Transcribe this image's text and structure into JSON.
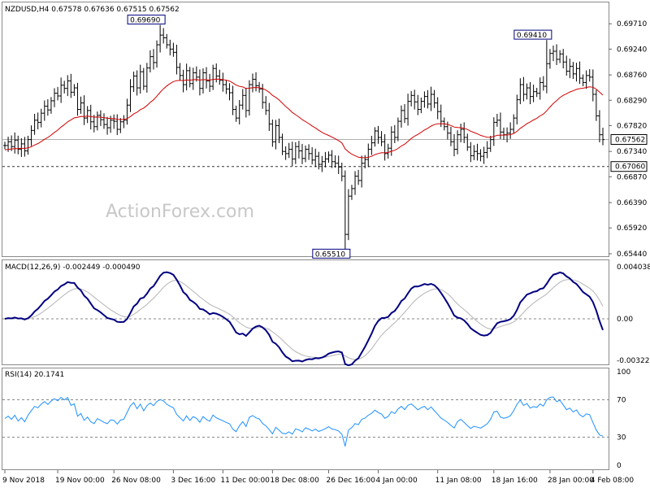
{
  "title_line": "NZDUSD,H4  0.67578  0.67636  0.67515  0.67562",
  "watermark": "ActionForex.com",
  "colors": {
    "price": "#000000",
    "ma": "#d20000",
    "macd_main": "#000080",
    "macd_signal": "#b4b4b4",
    "rsi": "#1e90ff",
    "grid_hline": "#888888",
    "panel_border": "#8a8a8a",
    "watermark": "#c8c8c8"
  },
  "chart_data": [
    {
      "type": "ohlc",
      "name": "price",
      "ylim": [
        0.6544,
        0.6991
      ],
      "price_ticks": [
        "0.69710",
        "0.69240",
        "0.68760",
        "0.68290",
        "0.67820",
        "0.67340",
        "0.66870",
        "0.66390",
        "0.65920",
        "0.65440"
      ],
      "last_price_label": "0.67562",
      "last_price": 0.67562,
      "hline_label": "0.67060",
      "hline": 0.6706,
      "annotations": [
        {
          "label": "0.69690",
          "value": 0.6969,
          "bar_index": 47
        },
        {
          "label": "0.69410",
          "value": 0.6941,
          "bar_index": 164
        },
        {
          "label": "0.65510",
          "value": 0.6551,
          "bar_index": 103
        }
      ],
      "closes": [
        0.6745,
        0.6752,
        0.6743,
        0.6755,
        0.6738,
        0.6748,
        0.6735,
        0.6756,
        0.6773,
        0.6792,
        0.6788,
        0.6805,
        0.6818,
        0.6811,
        0.6828,
        0.6842,
        0.6837,
        0.6857,
        0.6851,
        0.6865,
        0.6844,
        0.6852,
        0.6812,
        0.6824,
        0.6796,
        0.681,
        0.6789,
        0.678,
        0.6801,
        0.6793,
        0.6784,
        0.6778,
        0.6792,
        0.679,
        0.6775,
        0.6789,
        0.6792,
        0.682,
        0.6854,
        0.6874,
        0.6852,
        0.6882,
        0.6855,
        0.6889,
        0.691,
        0.6899,
        0.6932,
        0.695,
        0.6945,
        0.6932,
        0.6924,
        0.6918,
        0.689,
        0.6875,
        0.6858,
        0.6884,
        0.686,
        0.688,
        0.6872,
        0.6851,
        0.688,
        0.6865,
        0.6855,
        0.6888,
        0.6874,
        0.6866,
        0.6858,
        0.685,
        0.6843,
        0.6812,
        0.6796,
        0.682,
        0.6838,
        0.681,
        0.6858,
        0.6868,
        0.6856,
        0.685,
        0.6825,
        0.681,
        0.6785,
        0.6752,
        0.6782,
        0.676,
        0.6734,
        0.673,
        0.6738,
        0.672,
        0.6743,
        0.6735,
        0.6721,
        0.6738,
        0.673,
        0.6718,
        0.6725,
        0.671,
        0.6715,
        0.672,
        0.6727,
        0.6715,
        0.6712,
        0.6705,
        0.6688,
        0.658,
        0.6651,
        0.6665,
        0.6688,
        0.668,
        0.6712,
        0.6719,
        0.6738,
        0.675,
        0.6772,
        0.676,
        0.6752,
        0.673,
        0.674,
        0.677,
        0.676,
        0.679,
        0.681,
        0.6795,
        0.6827,
        0.6838,
        0.6826,
        0.6812,
        0.6827,
        0.6836,
        0.6822,
        0.684,
        0.6824,
        0.6808,
        0.679,
        0.678,
        0.6768,
        0.6752,
        0.6738,
        0.6765,
        0.6775,
        0.676,
        0.6742,
        0.6726,
        0.6734,
        0.673,
        0.6725,
        0.6732,
        0.674,
        0.6756,
        0.6788,
        0.6792,
        0.677,
        0.6765,
        0.6768,
        0.6775,
        0.6796,
        0.683,
        0.6858,
        0.684,
        0.6852,
        0.6836,
        0.6845,
        0.6842,
        0.6862,
        0.6855,
        0.6897,
        0.6916,
        0.692,
        0.6905,
        0.6915,
        0.69,
        0.6883,
        0.6892,
        0.6878,
        0.6888,
        0.687,
        0.6862,
        0.6875,
        0.6872,
        0.684,
        0.68,
        0.6765,
        0.6756
      ]
    },
    {
      "type": "line",
      "name": "MACD(12,26,9) -0.002449 -0.000490",
      "ylim": [
        -0.003221,
        0.004038
      ],
      "tick_labels": [
        "0.004038",
        "0.00",
        "-0.003221"
      ],
      "tick_values": [
        0.004038,
        0.0,
        -0.003221
      ]
    },
    {
      "type": "line",
      "name": "RSI(14) 20.1741",
      "ylim": [
        0,
        100
      ],
      "tick_labels": [
        "100",
        "70",
        "30",
        "0"
      ],
      "tick_values": [
        100,
        70,
        30,
        0
      ],
      "levels": [
        70,
        30
      ]
    }
  ],
  "x_tick_labels": [
    "9 Nov 2018",
    "19 Nov 00:00",
    "26 Nov 08:00",
    "3 Dec 16:00",
    "11 Dec 00:00",
    "18 Dec 08:00",
    "26 Dec 16:00",
    "4 Jan 00:00",
    "11 Jan 08:00",
    "18 Jan 16:00",
    "28 Jan 00:00",
    "4 Feb 08:00"
  ],
  "x_tick_bar_index": [
    0,
    16,
    33,
    51,
    66,
    81,
    98,
    113,
    131,
    148,
    165,
    178
  ]
}
